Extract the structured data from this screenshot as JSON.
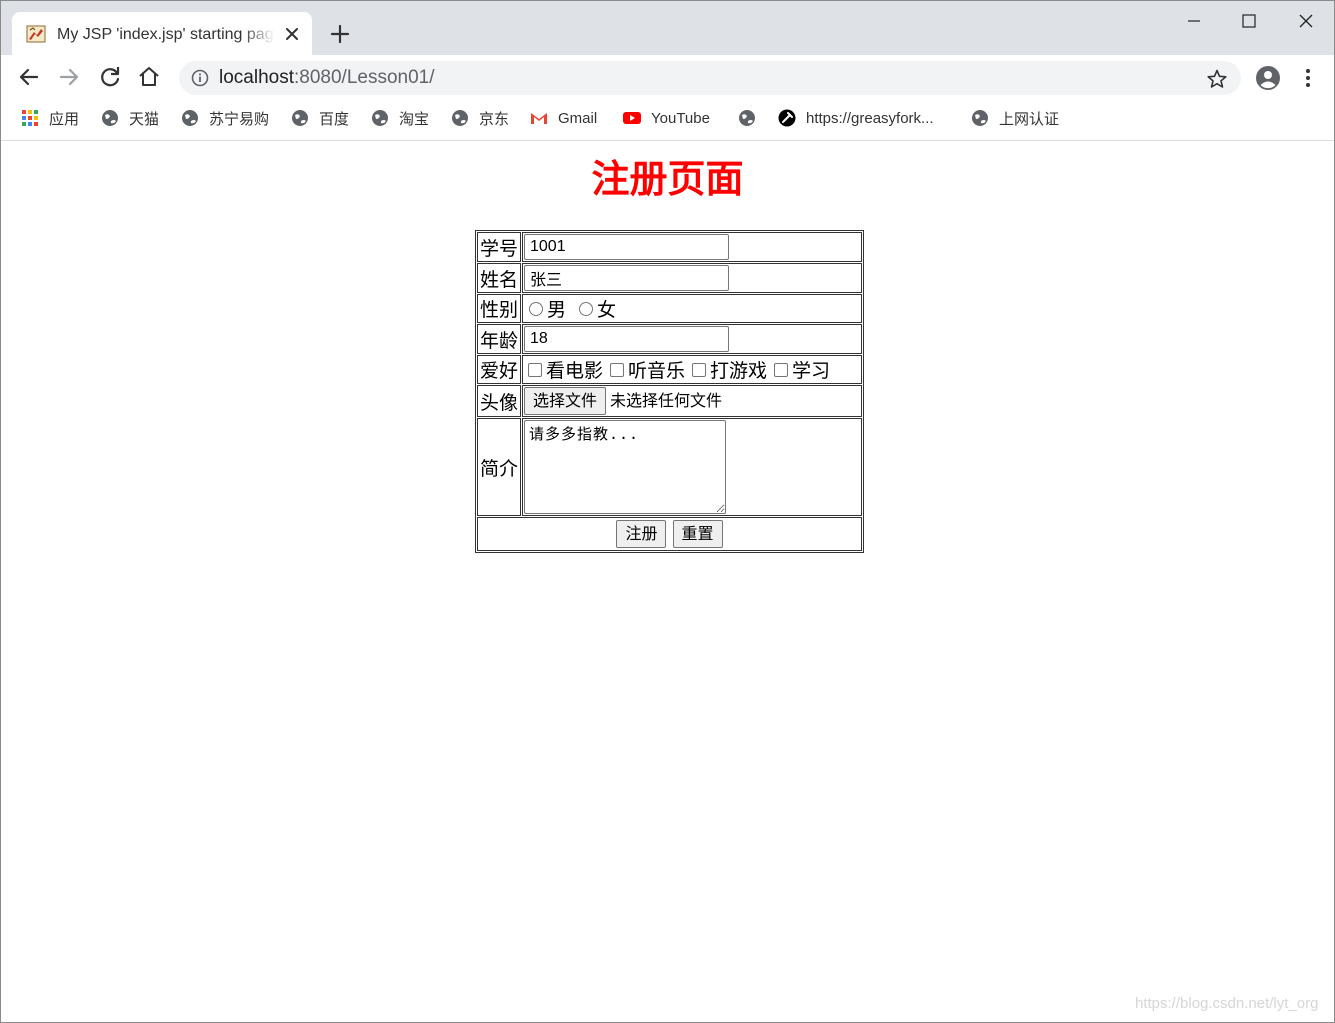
{
  "browser": {
    "tab": {
      "title": "My JSP 'index.jsp' starting page"
    },
    "address": {
      "host": "localhost",
      "rest": ":8080/Lesson01/"
    },
    "bookmarks": [
      {
        "label": "应用",
        "icon": "apps-grid-icon"
      },
      {
        "label": "天猫",
        "icon": "globe-icon"
      },
      {
        "label": "苏宁易购",
        "icon": "globe-icon"
      },
      {
        "label": "百度",
        "icon": "globe-icon"
      },
      {
        "label": "淘宝",
        "icon": "globe-icon"
      },
      {
        "label": "京东",
        "icon": "globe-icon"
      },
      {
        "label": "Gmail",
        "icon": "gmail-icon"
      },
      {
        "label": "YouTube",
        "icon": "youtube-icon"
      },
      {
        "label": "",
        "icon": "globe-icon"
      },
      {
        "label": "https://greasyfork...",
        "icon": "greasyfork-icon"
      },
      {
        "label": "上网认证",
        "icon": "globe-icon"
      }
    ]
  },
  "page": {
    "heading": "注册页面",
    "form": {
      "student_id": {
        "label": "学号",
        "value": "1001"
      },
      "name": {
        "label": "姓名",
        "value": "张三"
      },
      "gender": {
        "label": "性别",
        "options": [
          "男",
          "女"
        ]
      },
      "age": {
        "label": "年龄",
        "value": "18"
      },
      "hobbies": {
        "label": "爱好",
        "options": [
          "看电影",
          "听音乐",
          "打游戏",
          "学习"
        ]
      },
      "avatar": {
        "label": "头像",
        "button": "选择文件",
        "status": "未选择任何文件"
      },
      "intro": {
        "label": "简介",
        "value": "请多多指教..."
      },
      "submit": "注册",
      "reset": "重置"
    }
  },
  "watermark": "https://blog.csdn.net/lyt_org",
  "colors": {
    "heading": "#ff0000",
    "tabstrip": "#dee1e6",
    "omnibox": "#f1f3f4"
  }
}
